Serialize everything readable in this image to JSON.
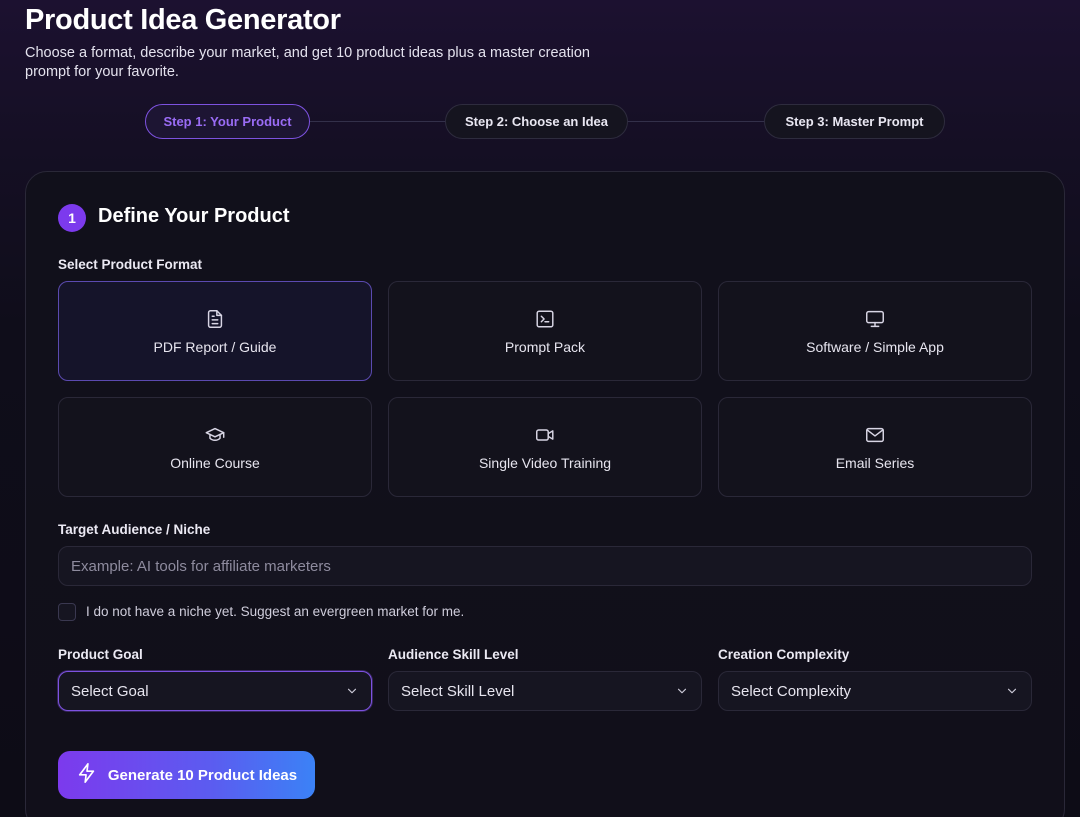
{
  "header": {
    "title": "Product Idea Generator",
    "subtitle": "Choose a format, describe your market, and get 10 product ideas plus a master creation prompt for your favorite."
  },
  "steps": [
    {
      "label": "Step 1: Your Product",
      "active": true
    },
    {
      "label": "Step 2: Choose an Idea",
      "active": false
    },
    {
      "label": "Step 3: Master Prompt",
      "active": false
    }
  ],
  "card": {
    "number": "1",
    "title": "Define Your Product"
  },
  "format": {
    "label": "Select Product Format",
    "selected": "PDF Report / Guide",
    "options": [
      {
        "label": "PDF Report / Guide",
        "icon": "document-icon"
      },
      {
        "label": "Prompt Pack",
        "icon": "terminal-icon"
      },
      {
        "label": "Software / Simple App",
        "icon": "monitor-icon"
      },
      {
        "label": "Online Course",
        "icon": "graduation-cap-icon"
      },
      {
        "label": "Single Video Training",
        "icon": "video-camera-icon"
      },
      {
        "label": "Email Series",
        "icon": "mail-icon"
      }
    ]
  },
  "audience": {
    "label": "Target Audience / Niche",
    "value": "",
    "placeholder": "Example: AI tools for affiliate marketers"
  },
  "no_niche": {
    "label": "I do not have a niche yet. Suggest an evergreen market for me.",
    "checked": false
  },
  "selects": {
    "goal": {
      "label": "Product Goal",
      "value": "Select Goal"
    },
    "skill": {
      "label": "Audience Skill Level",
      "value": "Select Skill Level"
    },
    "complexity": {
      "label": "Creation Complexity",
      "value": "Select Complexity"
    }
  },
  "generate_button": {
    "label": "Generate 10 Product Ideas",
    "icon": "lightning-icon"
  },
  "colors": {
    "accent": "#7c3aed",
    "accent_text": "#9a6cf5",
    "button_gradient_end": "#3b82f6",
    "background": "#0f0d1a"
  }
}
